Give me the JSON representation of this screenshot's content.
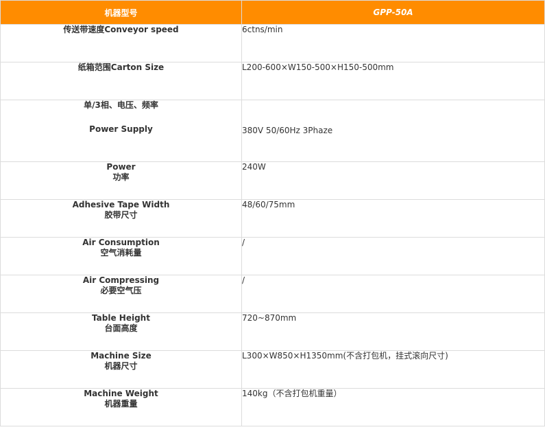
{
  "header": {
    "col1": "机器型号",
    "col2": "GPP-50A"
  },
  "rows": [
    {
      "label_lines": [
        "传送带速度Conveyor speed"
      ],
      "value": "6ctns/min"
    },
    {
      "label_lines": [
        "纸箱范围Carton Size"
      ],
      "value": "L200-600×W150-500×H150-500mm"
    },
    {
      "label_lines": [
        "单/3相、电压、频率",
        "Power Supply"
      ],
      "value": "380V 50/60Hz 3Phaze"
    },
    {
      "label_lines": [
        "Power",
        "功率"
      ],
      "value": "240W"
    },
    {
      "label_lines": [
        "Adhesive Tape Width",
        "胶带尺寸"
      ],
      "value": "48/60/75mm"
    },
    {
      "label_lines": [
        "Air Consumption",
        "空气消耗量"
      ],
      "value": "/"
    },
    {
      "label_lines": [
        "Air Compressing",
        "必要空气压"
      ],
      "value": "/"
    },
    {
      "label_lines": [
        "Table Height",
        "台面高度"
      ],
      "value": "720~870mm"
    },
    {
      "label_lines": [
        "Machine Size",
        "机器尺寸"
      ],
      "value": "L300×W850×H1350mm(不含打包机，挂式滚向尺寸)"
    },
    {
      "label_lines": [
        "Machine Weight",
        "机器重量"
      ],
      "value": "140kg（不含打包机重量）"
    }
  ],
  "colors": {
    "header_bg": "#ff8c00",
    "header_text": "#ffffff",
    "border": "#dcdcdc",
    "text": "#333333"
  }
}
